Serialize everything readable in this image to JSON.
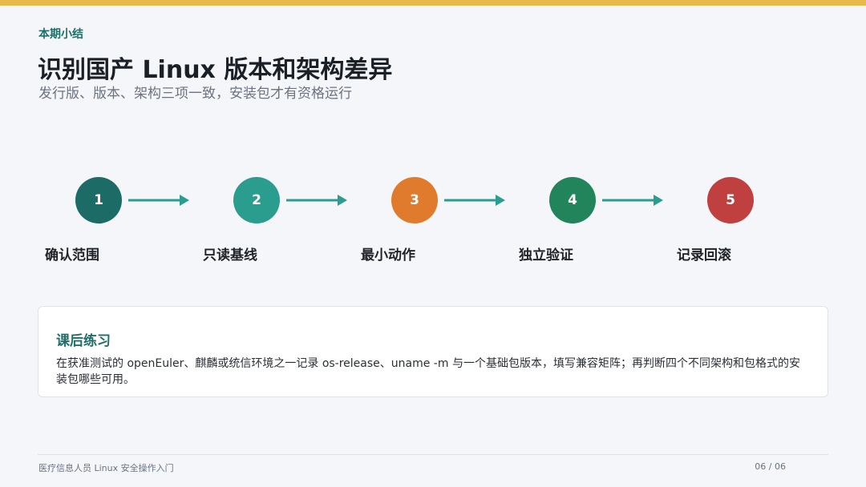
{
  "kicker": "本期小结",
  "title": "识别国产 Linux 版本和架构差异",
  "subtitle": "发行版、版本、架构三项一致，安装包才有资格运行",
  "steps": [
    {
      "number": "1",
      "label": "确认范围",
      "color": "#1c6b66"
    },
    {
      "number": "2",
      "label": "只读基线",
      "color": "#2a9d8f"
    },
    {
      "number": "3",
      "label": "最小动作",
      "color": "#e07b2e"
    },
    {
      "number": "4",
      "label": "独立验证",
      "color": "#22845a"
    },
    {
      "number": "5",
      "label": "记录回滚",
      "color": "#c0403f"
    }
  ],
  "arrow_color": "#2a9d8f",
  "card": {
    "title": "课后练习",
    "body": "在获准测试的 openEuler、麒麟或统信环境之一记录 os-release、uname -m 与一个基础包版本，填写兼容矩阵；再判断四个不同架构和包格式的安装包哪些可用。"
  },
  "footer": {
    "left": "医疗信息人员 Linux 安全操作入门",
    "right": "06 / 06"
  }
}
